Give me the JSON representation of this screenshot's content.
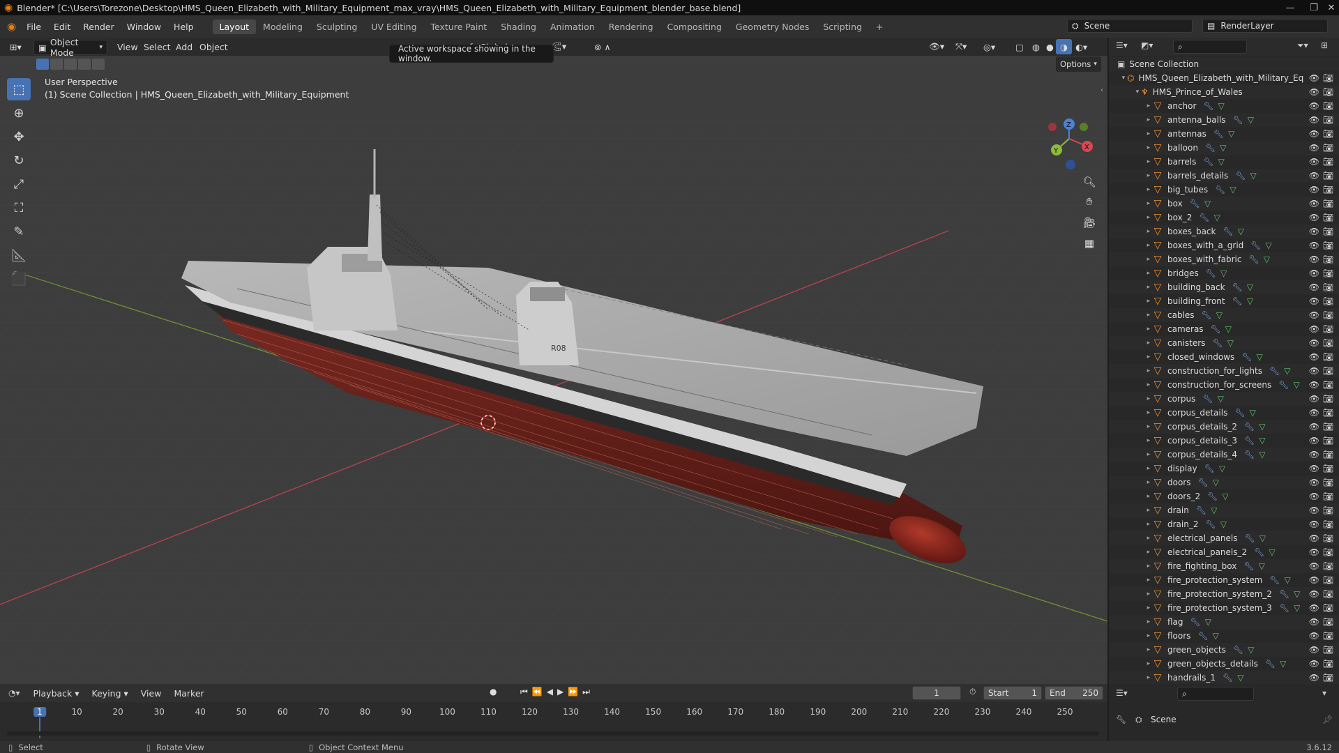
{
  "titlebar": {
    "title": "Blender* [C:\\Users\\Torezone\\Desktop\\HMS_Queen_Elizabeth_with_Military_Equipment_max_vray\\HMS_Queen_Elizabeth_with_Military_Equipment_blender_base.blend]"
  },
  "menu": [
    "File",
    "Edit",
    "Render",
    "Window",
    "Help"
  ],
  "workspaces": [
    "Layout",
    "Modeling",
    "Sculpting",
    "UV Editing",
    "Texture Paint",
    "Shading",
    "Animation",
    "Rendering",
    "Compositing",
    "Geometry Nodes",
    "Scripting"
  ],
  "active_workspace": "Layout",
  "scene": {
    "label": "Scene",
    "render_layer": "RenderLayer"
  },
  "viewport": {
    "mode": "Object Mode",
    "menus": [
      "View",
      "Select",
      "Add",
      "Object"
    ],
    "orientation": "Global",
    "options_label": "Options",
    "perspective_label": "User Perspective",
    "collection_label": "(1) Scene Collection | HMS_Queen_Elizabeth_with_Military_Equipment",
    "tooltip": "Active workspace showing in the window.",
    "hull_number": "R08",
    "gizmo_axes": [
      "X",
      "Y",
      "Z"
    ]
  },
  "outliner": {
    "root": "Scene Collection",
    "collection": "HMS_Queen_Elizabeth_with_Military_Eq",
    "group": "HMS_Prince_of_Wales",
    "items": [
      "anchor",
      "antenna_balls",
      "antennas",
      "balloon",
      "barrels",
      "barrels_details",
      "big_tubes",
      "box",
      "box_2",
      "boxes_back",
      "boxes_with_a_grid",
      "boxes_with_fabric",
      "bridges",
      "building_back",
      "building_front",
      "cables",
      "cameras",
      "canisters",
      "closed_windows",
      "construction_for_lights",
      "construction_for_screens",
      "corpus",
      "corpus_details",
      "corpus_details_2",
      "corpus_details_3",
      "corpus_details_4",
      "display",
      "doors",
      "doors_2",
      "drain",
      "drain_2",
      "electrical_panels",
      "electrical_panels_2",
      "fire_fighting_box",
      "fire_protection_system",
      "fire_protection_system_2",
      "fire_protection_system_3",
      "flag",
      "floors",
      "green_objects",
      "green_objects_details",
      "handrails_1"
    ]
  },
  "timeline": {
    "menus": [
      "Playback",
      "Keying",
      "View",
      "Marker"
    ],
    "current_frame": "1",
    "start_label": "Start",
    "start": "1",
    "end_label": "End",
    "end": "250",
    "ticks": [
      "1",
      "10",
      "20",
      "30",
      "40",
      "50",
      "60",
      "70",
      "80",
      "90",
      "100",
      "110",
      "120",
      "130",
      "140",
      "150",
      "160",
      "170",
      "180",
      "190",
      "200",
      "210",
      "220",
      "230",
      "240",
      "250"
    ]
  },
  "properties": {
    "scene": "Scene"
  },
  "statusbar": {
    "select": "Select",
    "rotate": "Rotate View",
    "context": "Object Context Menu",
    "version": "3.6.12"
  }
}
